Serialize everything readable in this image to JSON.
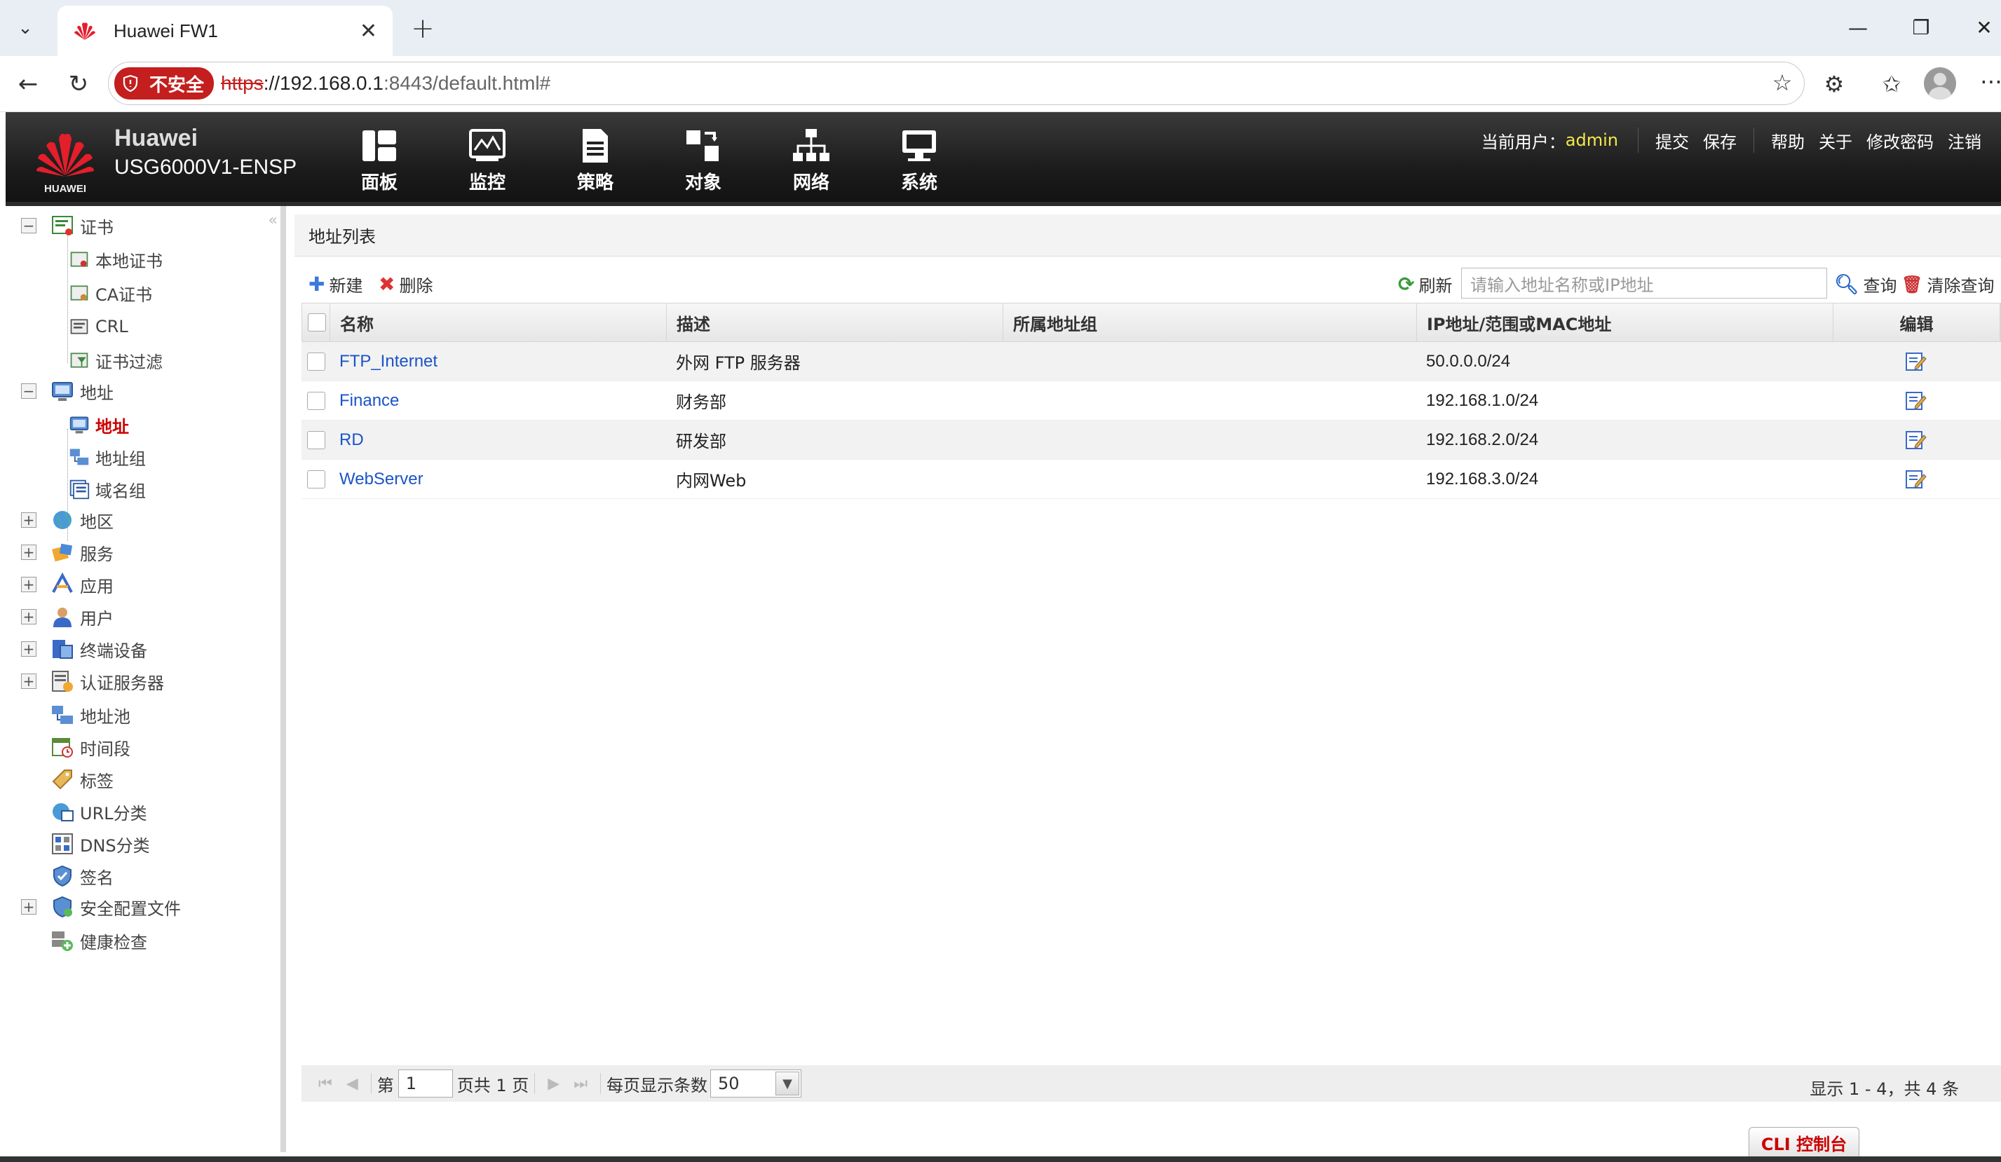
{
  "browser": {
    "tab_title": "Huawei FW1",
    "security_label": "不安全",
    "url_scheme": "https",
    "url_host": "://192.168.0.1",
    "url_rest": ":8443/default.html#"
  },
  "header": {
    "brand_name": "Huawei",
    "device_model": "USG6000V1-ENSP",
    "logo_text": "HUAWEI",
    "nav": [
      {
        "label": "面板",
        "icon": "dashboard-icon"
      },
      {
        "label": "监控",
        "icon": "monitor-icon"
      },
      {
        "label": "策略",
        "icon": "policy-icon"
      },
      {
        "label": "对象",
        "icon": "object-icon"
      },
      {
        "label": "网络",
        "icon": "network-icon"
      },
      {
        "label": "系统",
        "icon": "system-icon"
      }
    ],
    "current_user_label": "当前用户：",
    "current_user": "admin",
    "links": [
      "提交",
      "保存",
      "帮助",
      "关于",
      "修改密码",
      "注销"
    ]
  },
  "sidebar": {
    "items": [
      {
        "label": "证书",
        "expander": "−"
      },
      {
        "label": "本地证书"
      },
      {
        "label": "CA证书"
      },
      {
        "label": "CRL"
      },
      {
        "label": "证书过滤"
      },
      {
        "label": "地址",
        "expander": "−"
      },
      {
        "label": "地址",
        "selected": true
      },
      {
        "label": "地址组"
      },
      {
        "label": "域名组"
      },
      {
        "label": "地区",
        "expander": "+"
      },
      {
        "label": "服务",
        "expander": "+"
      },
      {
        "label": "应用",
        "expander": "+"
      },
      {
        "label": "用户",
        "expander": "+"
      },
      {
        "label": "终端设备",
        "expander": "+"
      },
      {
        "label": "认证服务器",
        "expander": "+"
      },
      {
        "label": "地址池"
      },
      {
        "label": "时间段"
      },
      {
        "label": "标签"
      },
      {
        "label": "URL分类"
      },
      {
        "label": "DNS分类"
      },
      {
        "label": "签名"
      },
      {
        "label": "安全配置文件",
        "expander": "+"
      },
      {
        "label": "健康检查"
      }
    ]
  },
  "main": {
    "title": "地址列表",
    "toolbar": {
      "new_label": "新建",
      "delete_label": "删除",
      "refresh_label": "刷新",
      "search_placeholder": "请输入地址名称或IP地址",
      "query_label": "查询",
      "clear_label": "清除查询"
    },
    "columns": [
      "名称",
      "描述",
      "所属地址组",
      "IP地址/范围或MAC地址",
      "编辑"
    ],
    "rows": [
      {
        "name": "FTP_Internet",
        "desc": "外网 FTP 服务器",
        "group": "",
        "ip": "50.0.0.0/24"
      },
      {
        "name": "Finance",
        "desc": "财务部",
        "group": "",
        "ip": "192.168.1.0/24"
      },
      {
        "name": "RD",
        "desc": "研发部",
        "group": "",
        "ip": "192.168.2.0/24"
      },
      {
        "name": "WebServer",
        "desc": "内网Web",
        "group": "",
        "ip": "192.168.3.0/24"
      }
    ],
    "pager": {
      "page_prefix": "第",
      "page_value": "1",
      "page_suffix": "页共 1 页",
      "per_page_label": "每页显示条数",
      "per_page_value": "50",
      "total": "显示 1 - 4，共 4 条"
    }
  },
  "cli_label": "CLI 控制台"
}
